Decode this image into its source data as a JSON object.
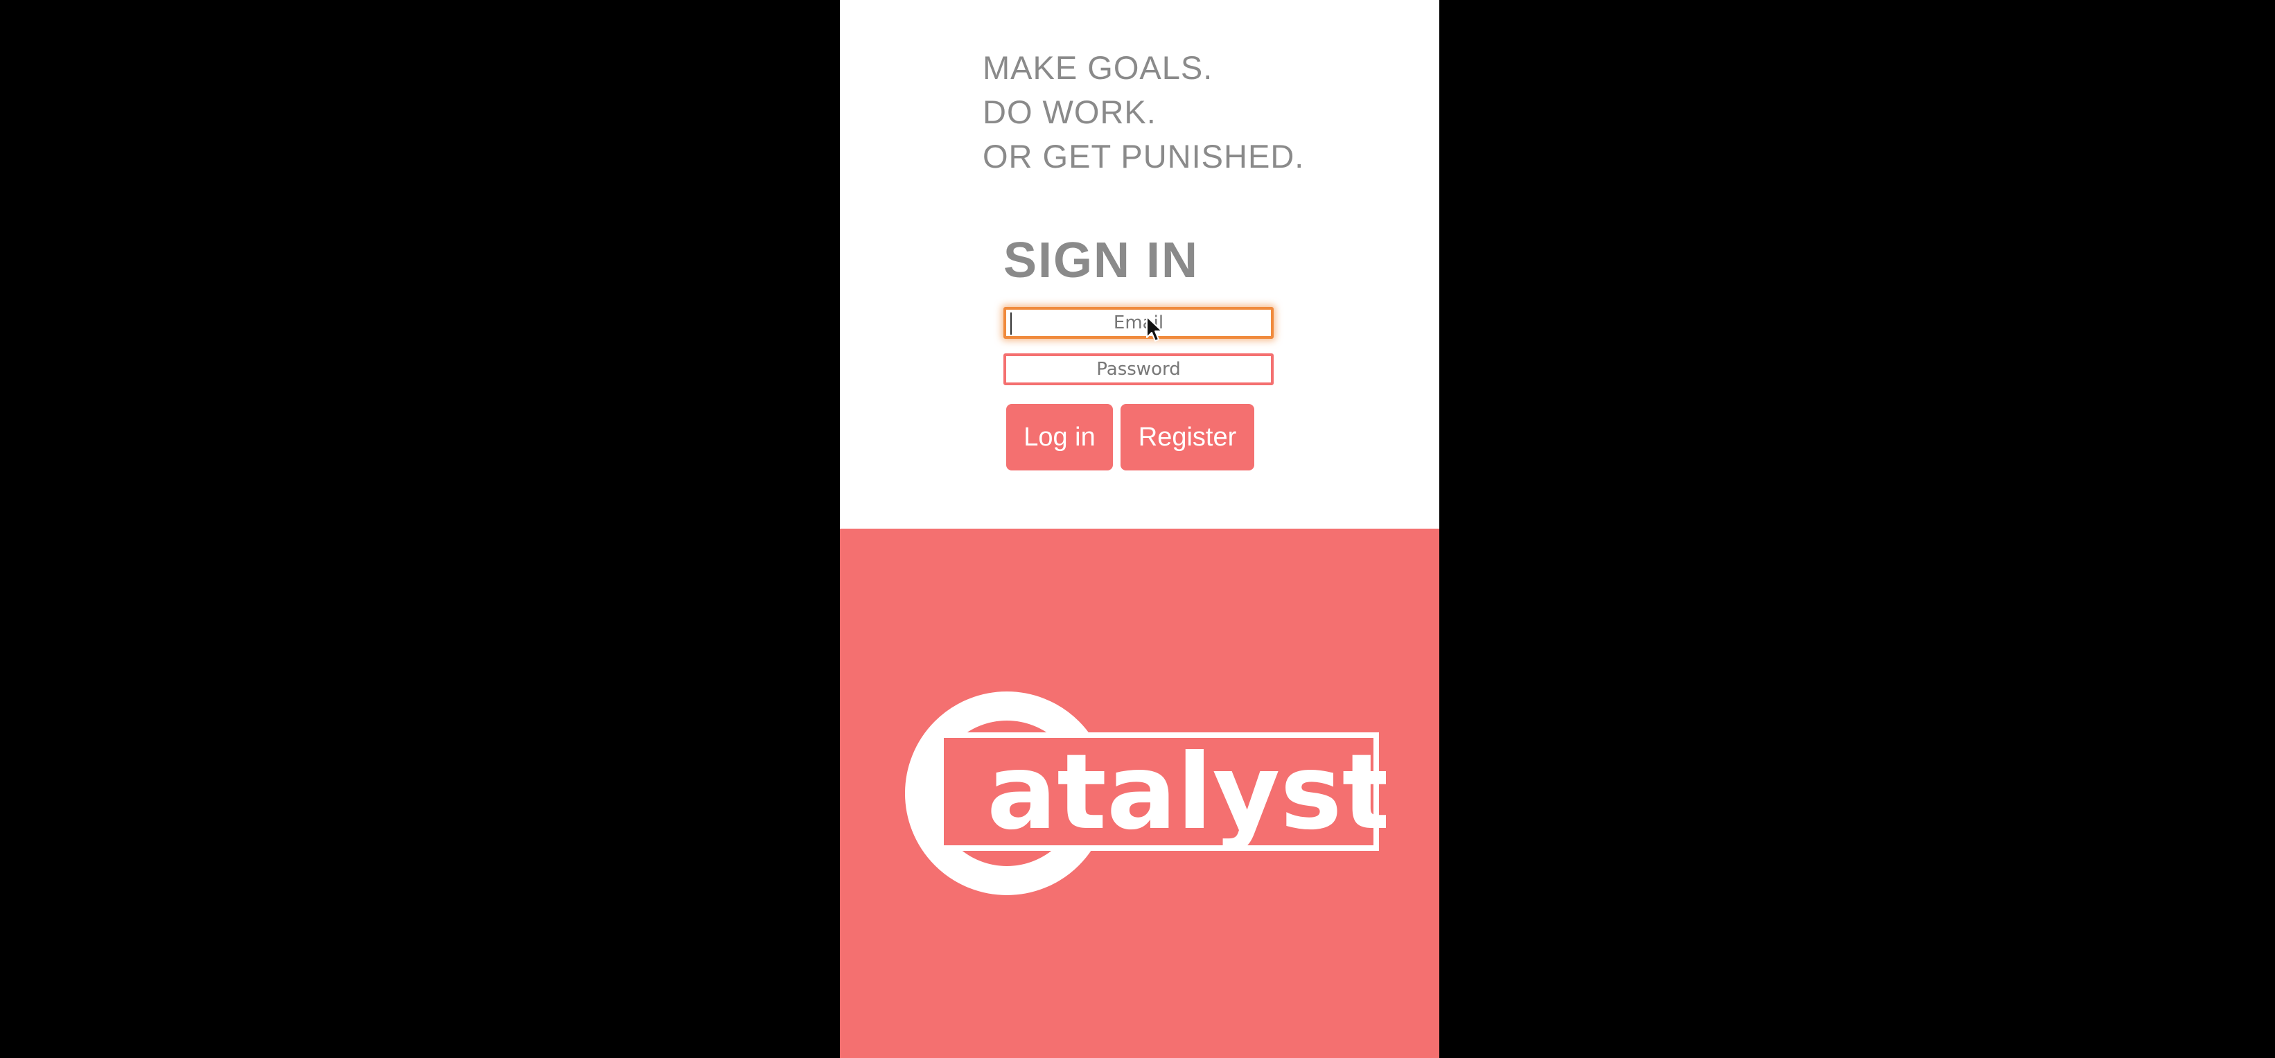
{
  "tagline": {
    "line1": "MAKE GOALS.",
    "line2": "DO WORK.",
    "line3": "OR GET PUNISHED."
  },
  "signin": {
    "title": "SIGN IN",
    "email_placeholder": "Email",
    "password_placeholder": "Password",
    "login_label": "Log in",
    "register_label": "Register"
  },
  "logo": {
    "text": "Catalyst",
    "rest_text": "atalyst"
  },
  "colors": {
    "accent": "#f47070",
    "focus": "#f08a3c",
    "text_gray": "#8a8a8a",
    "background": "#000000"
  },
  "icons": {
    "cursor": "mouse-pointer-icon"
  }
}
